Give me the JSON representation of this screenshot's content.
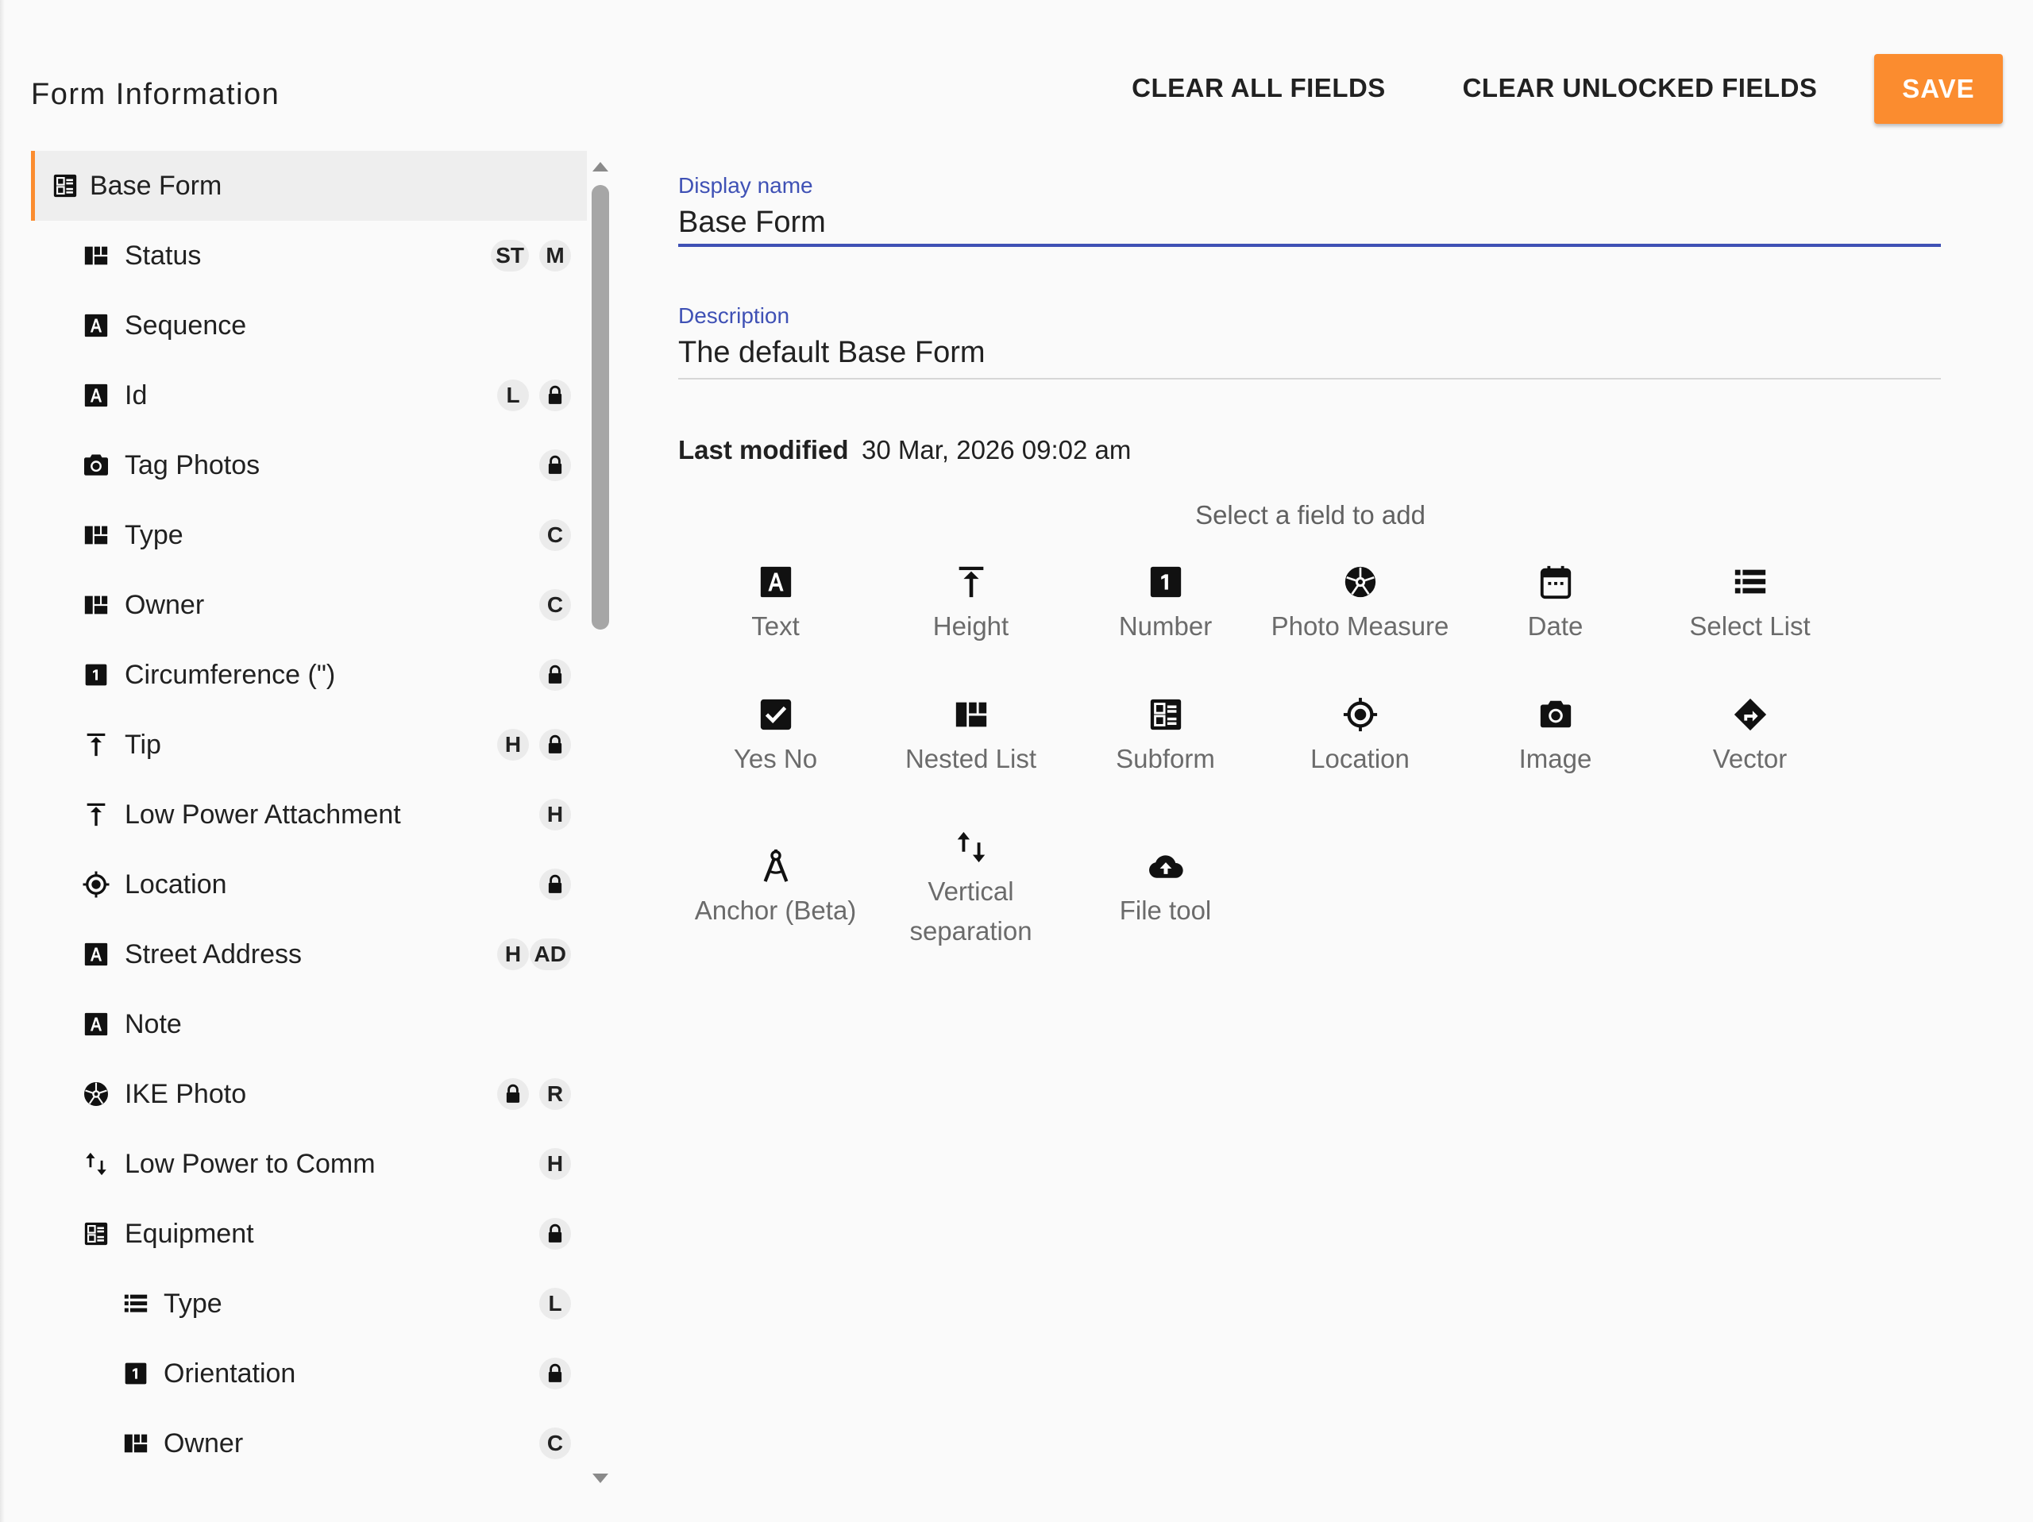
{
  "header": {
    "title": "Form Information",
    "clear_all_label": "CLEAR ALL FIELDS",
    "clear_unlocked_label": "CLEAR UNLOCKED FIELDS",
    "save_label": "SAVE"
  },
  "colors": {
    "accent": "#fb8c2f",
    "primary": "#3f51b5",
    "selected_bg": "#eeeeee"
  },
  "sidebar": {
    "items": [
      {
        "label": "Base Form",
        "icon": "subform-icon",
        "badges": []
      },
      {
        "label": "Status",
        "icon": "nested-list-icon",
        "badges": [
          "ST",
          "M"
        ]
      },
      {
        "label": "Sequence",
        "icon": "text-icon",
        "badges": []
      },
      {
        "label": "Id",
        "icon": "text-icon",
        "badges": [
          "L",
          "lock"
        ]
      },
      {
        "label": "Tag Photos",
        "icon": "camera-icon",
        "badges": [
          "lock"
        ]
      },
      {
        "label": "Type",
        "icon": "nested-list-icon",
        "badges": [
          "C"
        ]
      },
      {
        "label": "Owner",
        "icon": "nested-list-icon",
        "badges": [
          "C"
        ]
      },
      {
        "label": "Circumference (\")",
        "icon": "number-icon",
        "badges": [
          "lock"
        ]
      },
      {
        "label": "Tip",
        "icon": "height-icon",
        "badges": [
          "H",
          "lock"
        ]
      },
      {
        "label": "Low Power Attachment",
        "icon": "height-icon",
        "badges": [
          "H"
        ]
      },
      {
        "label": "Location",
        "icon": "location-icon",
        "badges": [
          "lock"
        ]
      },
      {
        "label": "Street Address",
        "icon": "text-icon",
        "badges": [
          "H",
          "AD"
        ]
      },
      {
        "label": "Note",
        "icon": "text-icon",
        "badges": []
      },
      {
        "label": "IKE Photo",
        "icon": "aperture-icon",
        "badges": [
          "lock",
          "R"
        ]
      },
      {
        "label": "Low Power to Comm",
        "icon": "vertical-separation-icon",
        "badges": [
          "H"
        ]
      },
      {
        "label": "Equipment",
        "icon": "subform-icon",
        "badges": [
          "lock"
        ]
      },
      {
        "label": "Type",
        "icon": "select-list-icon",
        "badges": [
          "L"
        ]
      },
      {
        "label": "Orientation",
        "icon": "number-icon",
        "badges": [
          "lock"
        ]
      },
      {
        "label": "Owner",
        "icon": "nested-list-icon",
        "badges": [
          "C"
        ]
      }
    ]
  },
  "form": {
    "display_name_label": "Display name",
    "display_name_value": "Base Form",
    "description_label": "Description",
    "description_value": "The default Base Form",
    "last_modified_label": "Last modified",
    "last_modified_value": "30 Mar, 2026 09:02 am"
  },
  "tools": {
    "hint": "Select a field to add",
    "items": [
      {
        "label": "Text",
        "icon": "text-icon"
      },
      {
        "label": "Height",
        "icon": "height-icon"
      },
      {
        "label": "Number",
        "icon": "number-icon"
      },
      {
        "label": "Photo Measure",
        "icon": "aperture-icon"
      },
      {
        "label": "Date",
        "icon": "calendar-icon"
      },
      {
        "label": "Select List",
        "icon": "select-list-icon"
      },
      {
        "label": "Yes No",
        "icon": "checkbox-icon"
      },
      {
        "label": "Nested List",
        "icon": "nested-list-icon"
      },
      {
        "label": "Subform",
        "icon": "subform-icon"
      },
      {
        "label": "Location",
        "icon": "location-icon"
      },
      {
        "label": "Image",
        "icon": "camera-icon"
      },
      {
        "label": "Vector",
        "icon": "direction-icon"
      },
      {
        "label": "Anchor (Beta)",
        "icon": "compass-icon"
      },
      {
        "label": "Vertical separation",
        "icon": "vertical-separation-icon"
      },
      {
        "label": "File tool",
        "icon": "cloud-upload-icon"
      }
    ]
  }
}
